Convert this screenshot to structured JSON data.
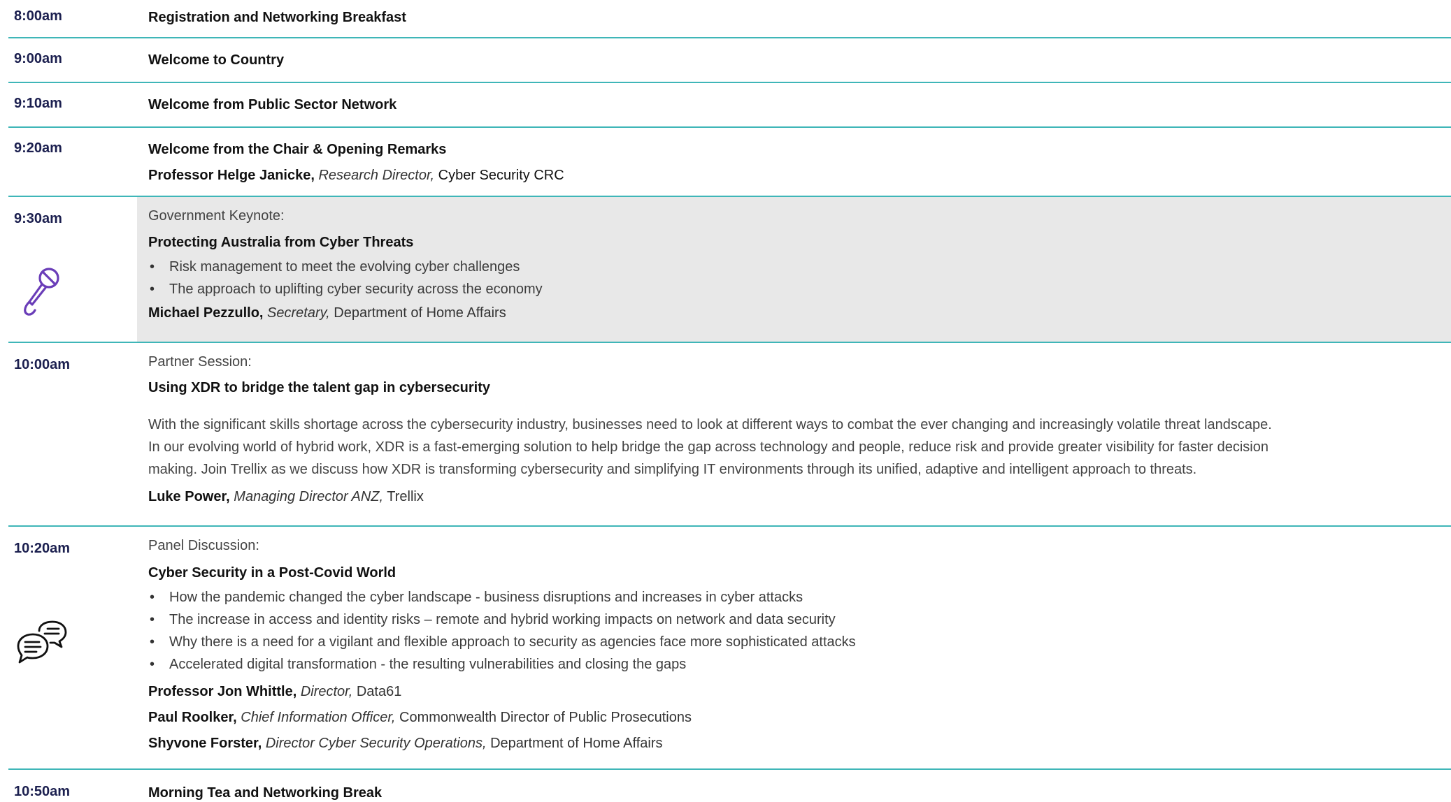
{
  "sessions": [
    {
      "time": "8:00am",
      "title": "Registration and Networking Breakfast"
    },
    {
      "time": "9:00am",
      "title": "Welcome to Country"
    },
    {
      "time": "9:10am",
      "title": "Welcome from Public Sector Network"
    },
    {
      "time": "9:20am",
      "title": "Welcome from the Chair & Opening Remarks",
      "speaker": {
        "name": "Professor Helge Janicke,",
        "role": "Research Director,",
        "org": "Cyber Security CRC"
      }
    },
    {
      "time": "9:30am",
      "label": "Government Keynote:",
      "title": "Protecting Australia from Cyber Threats",
      "icon": "microphone-icon",
      "bullets": [
        "Risk management to meet the evolving cyber challenges",
        "The approach to uplifting cyber security across the economy"
      ],
      "speaker": {
        "name": "Michael Pezzullo,",
        "role": "Secretary,",
        "org": "Department of Home Affairs"
      }
    },
    {
      "time": "10:00am",
      "label": "Partner Session:",
      "title": "Using XDR to bridge the talent gap in cybersecurity",
      "description": [
        "With the significant skills shortage across the cybersecurity industry, businesses need to look at different ways to combat the ever changing and increasingly volatile threat landscape.",
        "In our evolving world of hybrid work, XDR is a fast-emerging solution to help bridge the gap across technology and people, reduce risk and provide greater visibility for faster decision",
        "making. Join Trellix as we discuss how XDR is transforming cybersecurity and simplifying IT environments through its unified, adaptive and intelligent approach to threats."
      ],
      "speaker": {
        "name": "Luke Power,",
        "role": "Managing Director ANZ,",
        "org": "Trellix"
      }
    },
    {
      "time": "10:20am",
      "label": "Panel Discussion:",
      "title": "Cyber Security in a Post-Covid World",
      "icon": "chat-bubbles-icon",
      "bullets": [
        "How the pandemic changed the cyber landscape - business disruptions and increases in cyber attacks",
        "The increase in access and identity risks – remote and hybrid working impacts on network and data security",
        "Why there is a need for a vigilant and flexible approach to security as agencies face more sophisticated attacks",
        "Accelerated digital transformation - the resulting vulnerabilities and closing the gaps"
      ],
      "speakers": [
        {
          "name": "Professor Jon Whittle,",
          "role": "Director,",
          "org": "Data61"
        },
        {
          "name": "Paul Roolker,",
          "role": "Chief Information Officer,",
          "org": "Commonwealth Director of Public Prosecutions"
        },
        {
          "name": "Shyvone Forster,",
          "role": "Director Cyber Security Operations,",
          "org": "Department of Home Affairs"
        }
      ]
    },
    {
      "time": "10:50am",
      "title": "Morning Tea and Networking Break"
    }
  ],
  "colors": {
    "divider": "#3fb6b8",
    "time": "#1b1f4f",
    "icon": "#6a3db8",
    "highlight_bg": "#e8e8e8"
  }
}
